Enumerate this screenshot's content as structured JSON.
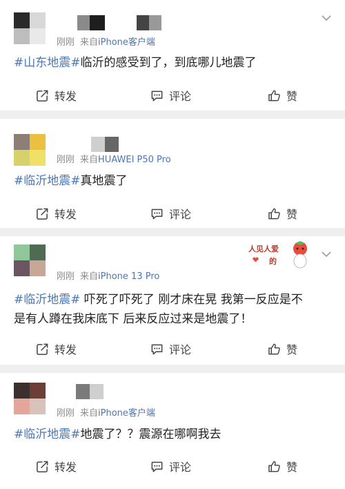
{
  "posts": [
    {
      "time": "刚刚",
      "from_prefix": "来自",
      "source": "iPhone客户端",
      "tag": "#山东地震#",
      "text": "临沂的感受到了，到底哪儿地震了",
      "text_line2": ""
    },
    {
      "time": "刚刚",
      "from_prefix": "来自",
      "source": "HUAWEI P50 Pro",
      "tag": "#临沂地震#",
      "text": "真地震了",
      "text_line2": ""
    },
    {
      "time": "刚刚",
      "from_prefix": "来自",
      "source": "iPhone 13 Pro",
      "tag": "#临沂地震#",
      "text": " 吓死了吓死了 刚才床在晃 我第一反应是不",
      "text_line2": "是有人蹲在我床底下 后来反应过来是地震了！",
      "sticker": {
        "line1": "人见人爱",
        "line2": "的"
      }
    },
    {
      "time": "刚刚",
      "from_prefix": "来自",
      "source": "iPhone客户端",
      "tag": "#临沂地震#",
      "text": "地震了？？震源在哪啊我去",
      "text_line2": ""
    }
  ],
  "actions": {
    "repost": "转发",
    "comment": "评论",
    "like": "赞"
  },
  "colors": {
    "link": "#4a76b6",
    "meta": "#8c8c8c",
    "background": "#efefef"
  }
}
